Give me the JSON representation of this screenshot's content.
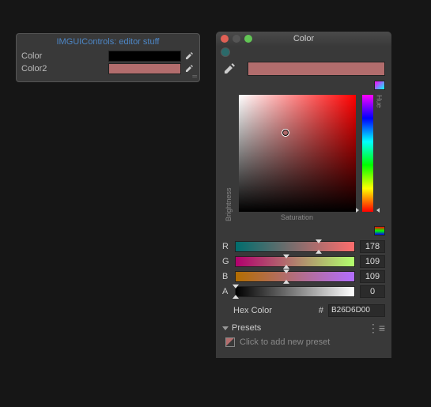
{
  "inspector": {
    "title": "IMGUIControls: editor stuff",
    "rows": [
      {
        "label": "Color",
        "color": "#000000"
      },
      {
        "label": "Color2",
        "color": "#B26D6D"
      }
    ]
  },
  "picker": {
    "title": "Color",
    "current_color": "#B26D6D",
    "sv": {
      "brightness_label": "Brightness",
      "saturation_label": "Saturation",
      "hue_label": "Hue"
    },
    "channels": {
      "r": {
        "label": "R",
        "value": "178",
        "pct": 69.8
      },
      "g": {
        "label": "G",
        "value": "109",
        "pct": 42.7
      },
      "b": {
        "label": "B",
        "value": "109",
        "pct": 42.7
      },
      "a": {
        "label": "A",
        "value": "0",
        "pct": 0
      }
    },
    "hex": {
      "label": "Hex Color",
      "hash": "#",
      "value": "B26D6D00"
    },
    "presets": {
      "title": "Presets",
      "hint": "Click to add new preset"
    }
  }
}
